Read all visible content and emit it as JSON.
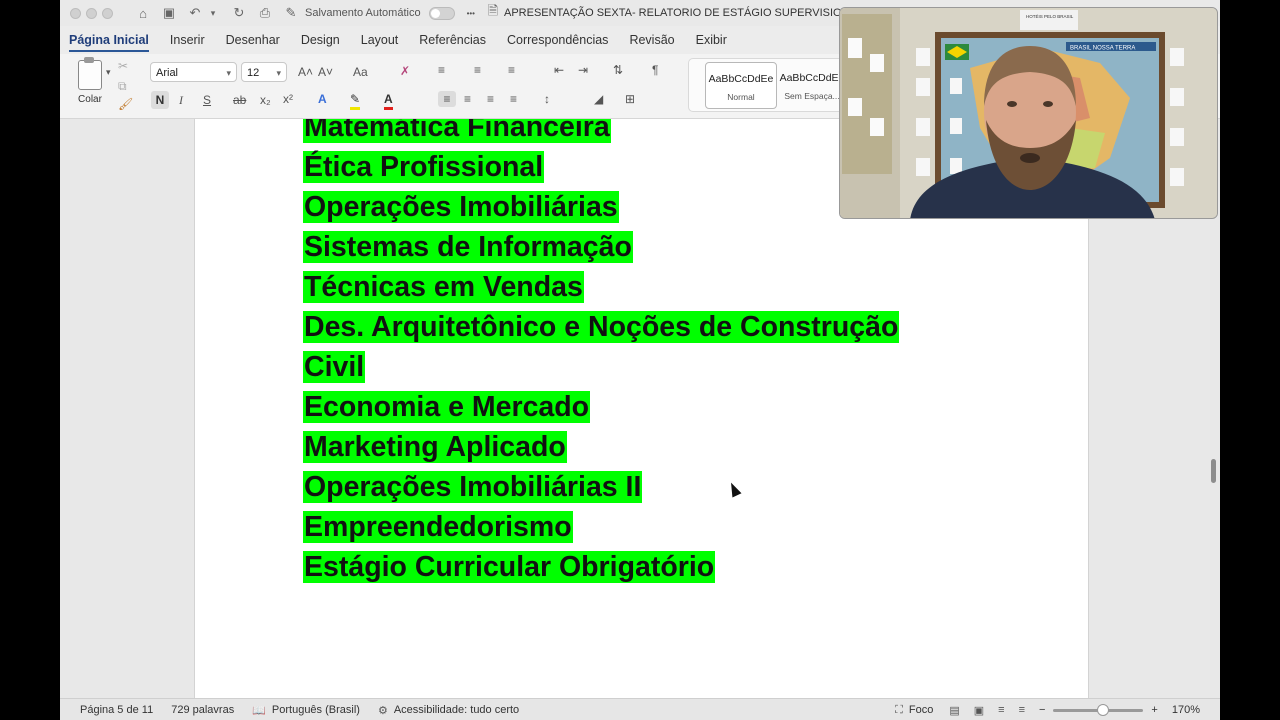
{
  "titlebar": {
    "autosave_label": "Salvamento Automático",
    "more": "•••",
    "doc_title": "APRESENTAÇÃO SEXTA- RELATORIO DE ESTÁGIO SUPERVISIONAD"
  },
  "tabs": [
    "Página Inicial",
    "Inserir",
    "Desenhar",
    "Design",
    "Layout",
    "Referências",
    "Correspondências",
    "Revisão",
    "Exibir"
  ],
  "ribbon": {
    "paste_label": "Colar",
    "font_name": "Arial",
    "font_size": "12",
    "bold": "N",
    "italic": "I",
    "underline": "S",
    "strike": "ab",
    "subscript": "x₂",
    "superscript": "x²",
    "grow": "A˄",
    "shrink": "A˅",
    "case": "Aa",
    "pilcrow": "¶",
    "styles": [
      {
        "sample": "AaBbCcDdEe",
        "name": "Normal"
      },
      {
        "sample": "AaBbCcDdEe",
        "name": "Sem Espaça..."
      }
    ]
  },
  "document": {
    "lines": [
      "Matemática Financeira",
      "Ética Profissional",
      "Operações Imobiliárias",
      "Sistemas de Informação",
      "Técnicas em Vendas",
      "Des. Arquitetônico e Noções de Construção",
      "Civil",
      "Economia e Mercado",
      "Marketing Aplicado",
      "Operações Imobiliárias II",
      "Empreendedorismo",
      "Estágio Curricular Obrigatório"
    ],
    "highlight_color": "#00ff00"
  },
  "status": {
    "page": "Página 5 de 11",
    "words": "729 palavras",
    "language": "Português (Brasil)",
    "accessibility": "Acessibilidade: tudo certo",
    "focus": "Foco",
    "zoom_minus": "−",
    "zoom_plus": "+",
    "zoom": "170%",
    "zoom_level_fraction": 0.55
  },
  "webcam": {
    "map_title": "BRASIL NOSSA TERRA",
    "sign_text": "HOTÉIS PELO BRASIL"
  }
}
